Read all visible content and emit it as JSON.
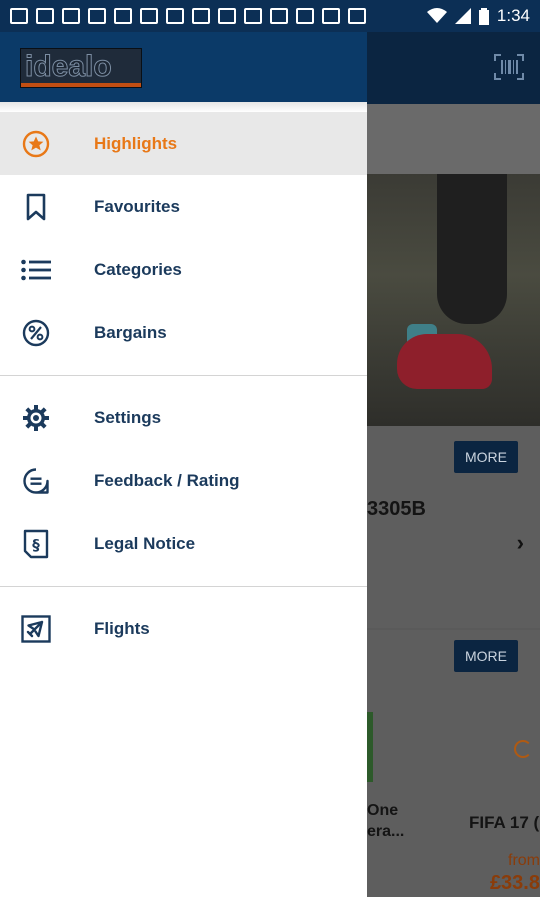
{
  "status_bar": {
    "time": "1:34",
    "icons": [
      "message-icon",
      "square-icon",
      "square-icon",
      "square-icon",
      "square-icon",
      "square-icon",
      "square-icon",
      "square-icon",
      "square-icon",
      "square-icon",
      "square-icon",
      "square-icon",
      "square-icon",
      "square-icon",
      "wifi-icon",
      "signal-icon",
      "battery-icon"
    ]
  },
  "drawer": {
    "logo_text": "idealo",
    "items": [
      {
        "label": "Highlights",
        "icon": "star-circle-icon",
        "active": true
      },
      {
        "label": "Favourites",
        "icon": "bookmark-icon",
        "active": false
      },
      {
        "label": "Categories",
        "icon": "list-icon",
        "active": false
      },
      {
        "label": "Bargains",
        "icon": "percent-circle-icon",
        "active": false
      }
    ],
    "items_2": [
      {
        "label": "Settings",
        "icon": "gear-icon"
      },
      {
        "label": "Feedback / Rating",
        "icon": "chat-bubble-icon"
      },
      {
        "label": "Legal Notice",
        "icon": "paragraph-icon"
      }
    ],
    "items_3": [
      {
        "label": "Flights",
        "icon": "airplane-icon"
      }
    ]
  },
  "background": {
    "more_label_1": "MORE",
    "more_label_2": "MORE",
    "product_code": "3305B",
    "product_1_name_line1": "One",
    "product_1_name_line2": "era...",
    "product_2_name": "FIFA 17 (",
    "price_prefix": "from",
    "price": "£33.8"
  },
  "colors": {
    "brand_blue": "#0b3a68",
    "accent_orange": "#e87817",
    "label_blue": "#1b3a5c"
  }
}
